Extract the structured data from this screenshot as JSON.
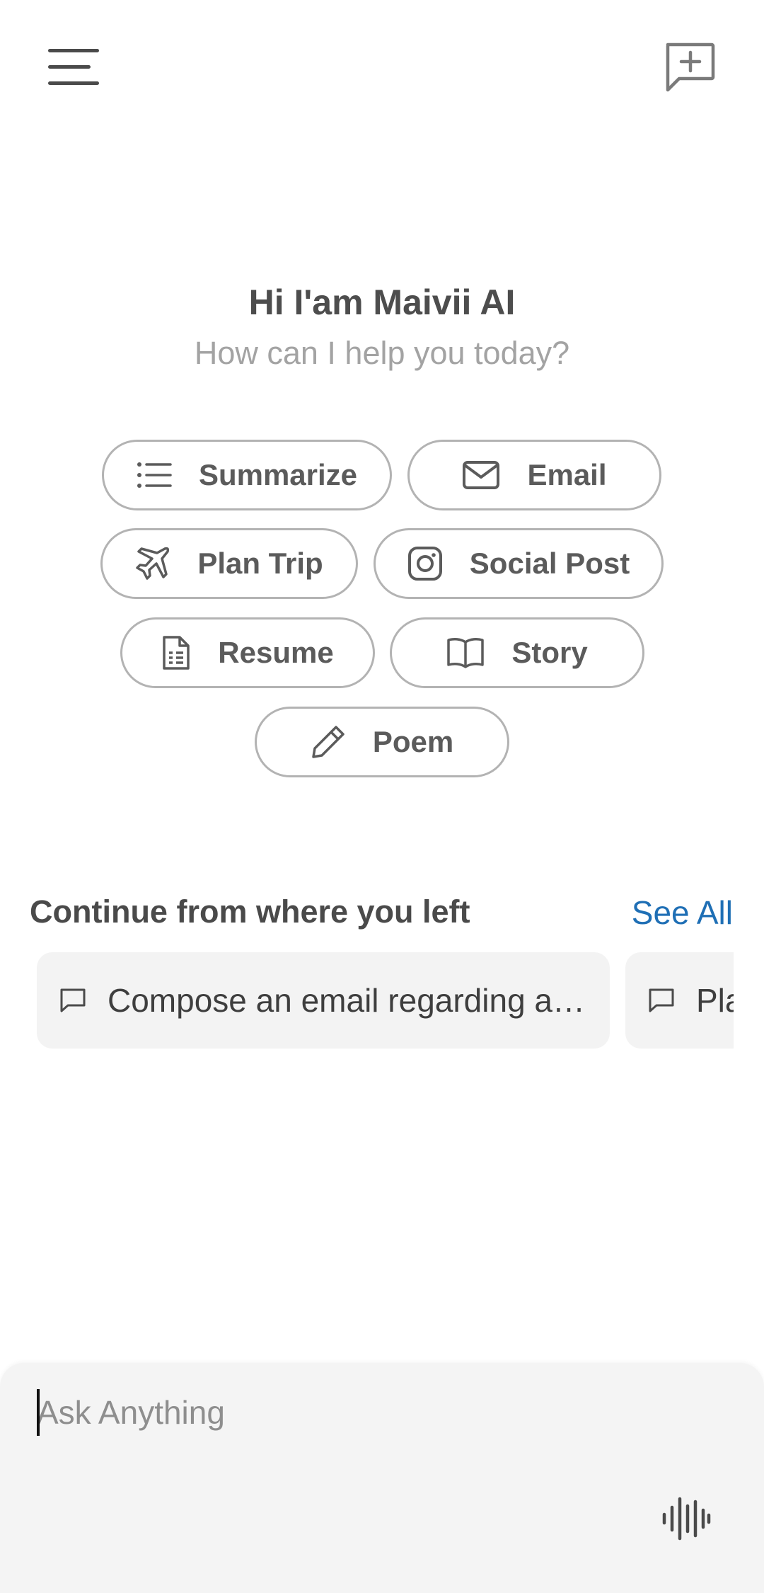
{
  "header": {
    "menu_icon": "hamburger-menu-icon",
    "new_chat_icon": "new-chat-icon"
  },
  "greeting": {
    "title": "Hi I'am Maivii AI",
    "subtitle": "How can I help you today?"
  },
  "suggestions": [
    {
      "label": "Summarize",
      "icon": "list-icon"
    },
    {
      "label": "Email",
      "icon": "mail-icon"
    },
    {
      "label": "Plan Trip",
      "icon": "airplane-icon"
    },
    {
      "label": "Social Post",
      "icon": "instagram-icon"
    },
    {
      "label": "Resume",
      "icon": "document-icon"
    },
    {
      "label": "Story",
      "icon": "book-icon"
    },
    {
      "label": "Poem",
      "icon": "pencil-icon"
    }
  ],
  "recent": {
    "title": "Continue from where you left",
    "see_all": "See All",
    "items": [
      {
        "text": "Compose an email regarding a…",
        "icon": "chat-bubble-icon"
      },
      {
        "text": "Pla",
        "icon": "chat-bubble-icon"
      }
    ]
  },
  "composer": {
    "placeholder": "Ask Anything",
    "voice_icon": "voice-waveform-icon"
  },
  "colors": {
    "accent_link": "#1f6fb5",
    "chip_border": "#b3b3b3",
    "composer_bg": "#f4f4f4",
    "card_bg": "#f3f3f3"
  }
}
